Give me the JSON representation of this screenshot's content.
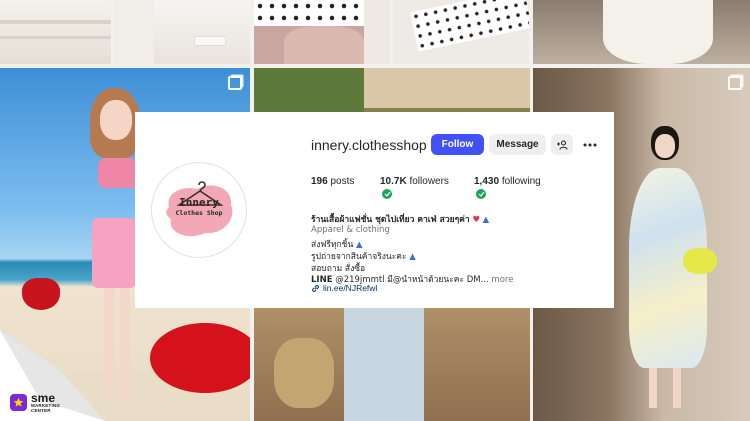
{
  "profile": {
    "username": "innery.clothesshop",
    "follow_label": "Follow",
    "message_label": "Message",
    "avatar_logo_title": "Innery",
    "avatar_logo_sub": "Clothes Shop",
    "stats": {
      "posts_count": "196",
      "posts_label": "posts",
      "followers_count": "10.7K",
      "followers_label": "followers",
      "following_count": "1,430",
      "following_label": "following"
    },
    "bio": {
      "name": "ร้านเสื้อผ้าแฟชั่น ชุดไปเที่ยว คาเฟ่ สวยๆค่า",
      "category": "Apparel & clothing",
      "line1": "ส่งฟรีทุกชิ้น",
      "line2": "รูปถ่ายจากสินค้าจริงนะคะ",
      "line3": "สอบถาม สั่งซื้อ",
      "line4_prefix": "LINE",
      "line4_text": " @219jmmtl มี@นำหน้าด้วยนะคะ DM...",
      "more_label": " more",
      "link": "lin.ee/NJRefwl"
    },
    "icons": {
      "heart": "heart-emoji",
      "dress": "dress-emoji",
      "verified": "verified-check-icon",
      "link": "link-icon",
      "suggest": "add-person-icon",
      "more": "more-dots-icon",
      "multi": "multiple-photos-icon"
    },
    "colors": {
      "follow_button": "#4150f7",
      "avatar_blob": "#f2a9b5",
      "verified": "#1aa55a"
    }
  },
  "watermark": {
    "brand": "sme",
    "sub1": "MARKETING",
    "sub2": "CENTER"
  }
}
